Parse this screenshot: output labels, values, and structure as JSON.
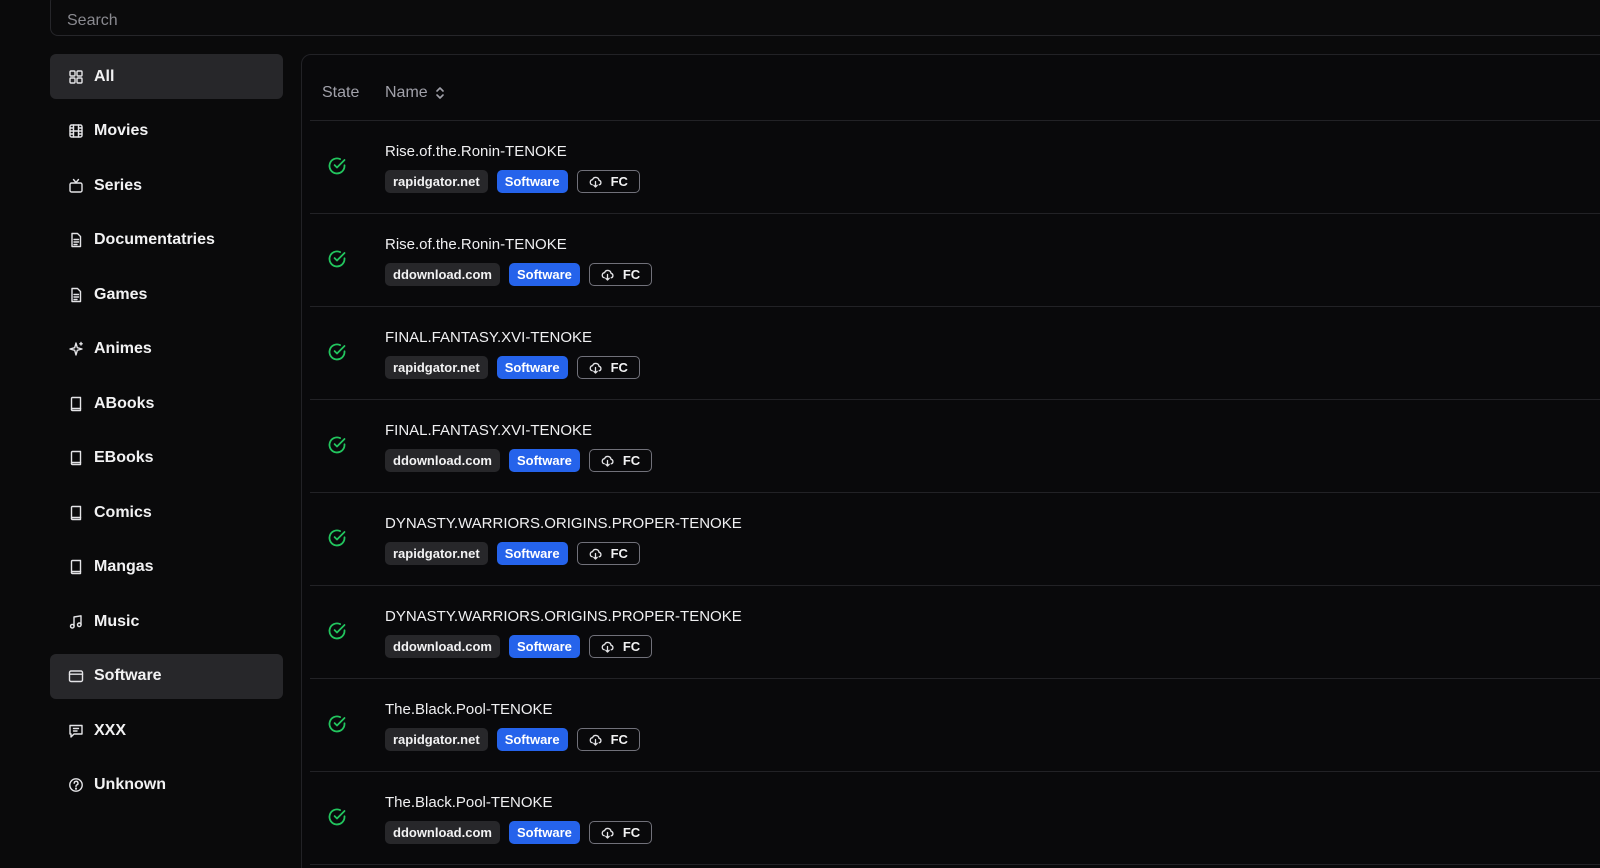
{
  "search": {
    "placeholder": "Search"
  },
  "sidebar": {
    "items": [
      {
        "label": "All",
        "icon": "grid-icon"
      },
      {
        "label": "Movies",
        "icon": "film-icon"
      },
      {
        "label": "Series",
        "icon": "tv-icon"
      },
      {
        "label": "Documentatries",
        "icon": "document-icon"
      },
      {
        "label": "Games",
        "icon": "document-icon"
      },
      {
        "label": "Animes",
        "icon": "sparkles-icon"
      },
      {
        "label": "ABooks",
        "icon": "book-icon"
      },
      {
        "label": "EBooks",
        "icon": "book-icon"
      },
      {
        "label": "Comics",
        "icon": "book-icon"
      },
      {
        "label": "Mangas",
        "icon": "book-icon"
      },
      {
        "label": "Music",
        "icon": "music-icon"
      },
      {
        "label": "Software",
        "icon": "browser-window-icon"
      },
      {
        "label": "XXX",
        "icon": "message-square-icon"
      },
      {
        "label": "Unknown",
        "icon": "help-circle-icon"
      }
    ],
    "active": "Software"
  },
  "table": {
    "headers": {
      "state": "State",
      "name": "Name"
    },
    "rows": [
      {
        "name": "Rise.of.the.Ronin-TENOKE",
        "host": "rapidgator.net",
        "category": "Software",
        "badge": "FC",
        "state": "done"
      },
      {
        "name": "Rise.of.the.Ronin-TENOKE",
        "host": "ddownload.com",
        "category": "Software",
        "badge": "FC",
        "state": "done"
      },
      {
        "name": "FINAL.FANTASY.XVI-TENOKE",
        "host": "rapidgator.net",
        "category": "Software",
        "badge": "FC",
        "state": "done"
      },
      {
        "name": "FINAL.FANTASY.XVI-TENOKE",
        "host": "ddownload.com",
        "category": "Software",
        "badge": "FC",
        "state": "done"
      },
      {
        "name": "DYNASTY.WARRIORS.ORIGINS.PROPER-TENOKE",
        "host": "rapidgator.net",
        "category": "Software",
        "badge": "FC",
        "state": "done"
      },
      {
        "name": "DYNASTY.WARRIORS.ORIGINS.PROPER-TENOKE",
        "host": "ddownload.com",
        "category": "Software",
        "badge": "FC",
        "state": "done"
      },
      {
        "name": "The.Black.Pool-TENOKE",
        "host": "rapidgator.net",
        "category": "Software",
        "badge": "FC",
        "state": "done"
      },
      {
        "name": "The.Black.Pool-TENOKE",
        "host": "ddownload.com",
        "category": "Software",
        "badge": "FC",
        "state": "done"
      }
    ]
  },
  "colors": {
    "accent": "#2563eb",
    "success": "#22c55e",
    "active_bg": "#27272a"
  }
}
